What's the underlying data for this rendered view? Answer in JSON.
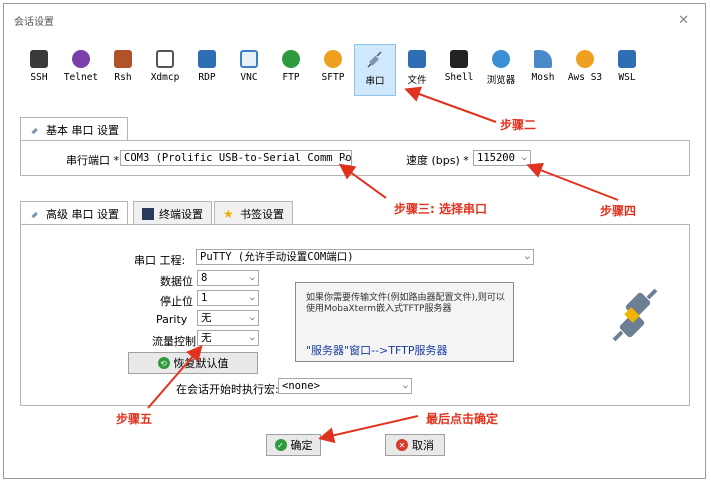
{
  "window": {
    "title": "会话设置",
    "close_glyph": "✕"
  },
  "toolbar": {
    "items": [
      {
        "label": "SSH",
        "icon": "ssh-icon",
        "color": "#3a3a3a"
      },
      {
        "label": "Telnet",
        "icon": "telnet-icon",
        "color": "#7a3fa8"
      },
      {
        "label": "Rsh",
        "icon": "rsh-icon",
        "color": "#b0522a"
      },
      {
        "label": "Xdmcp",
        "icon": "xdmcp-icon",
        "color": "#555555"
      },
      {
        "label": "RDP",
        "icon": "rdp-icon",
        "color": "#2f6db5"
      },
      {
        "label": "VNC",
        "icon": "vnc-icon",
        "color": "#3b7fc4"
      },
      {
        "label": "FTP",
        "icon": "ftp-icon",
        "color": "#2e9a3e"
      },
      {
        "label": "SFTP",
        "icon": "sftp-icon",
        "color": "#f0a020"
      },
      {
        "label": "串口",
        "icon": "serial-plug-icon",
        "color": "#6f8fb0",
        "selected": true
      },
      {
        "label": "文件",
        "icon": "file-icon",
        "color": "#2f6db5"
      },
      {
        "label": "Shell",
        "icon": "shell-icon",
        "color": "#222222"
      },
      {
        "label": "浏览器",
        "icon": "browser-icon",
        "color": "#3a8fd4"
      },
      {
        "label": "Mosh",
        "icon": "mosh-icon",
        "color": "#4a8ac8"
      },
      {
        "label": "Aws S3",
        "icon": "aws-icon",
        "color": "#f0a020"
      },
      {
        "label": "WSL",
        "icon": "wsl-icon",
        "color": "#2f6db5"
      }
    ]
  },
  "basic": {
    "tab_label": "基本 串口 设置",
    "port_label": "串行端口 *",
    "port_value": "COM3  (Prolific USB-to-Serial Comm Port",
    "speed_label": "速度 (bps) *",
    "speed_value": "115200"
  },
  "advanced": {
    "tabs": [
      "高级 串口 设置",
      "终端设置",
      "书签设置"
    ],
    "engine_label": "串口 工程:",
    "engine_value": "PuTTY  (允许手动设置COM端口)",
    "databits_label": "数据位",
    "databits_value": "8",
    "stopbits_label": "停止位",
    "stopbits_value": "1",
    "parity_label": "Parity",
    "parity_value": "无",
    "flow_label": "流量控制",
    "flow_value": "无",
    "restore_button": "恢复默认值",
    "macro_label": "在会话开始时执行宏:",
    "macro_value": "<none>",
    "info_text": "如果你需要传输文件(例如路由器配置文件),则可以使用MobaXterm嵌入式TFTP服务器",
    "info_link": "\"服务器\"窗口-->TFTP服务器"
  },
  "buttons": {
    "ok": "确定",
    "cancel": "取消"
  },
  "annotations": {
    "step2": "步骤二",
    "step3": "步骤三: 选择串口",
    "step4": "步骤四",
    "step5": "步骤五",
    "last": "最后点击确定",
    "color": "#e0321e"
  }
}
